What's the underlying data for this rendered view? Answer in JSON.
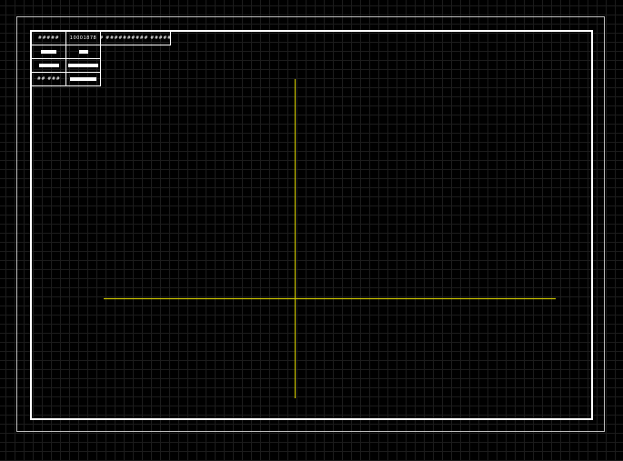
{
  "drawing": {
    "background": "#000000",
    "grid_color": "#1c1c1c",
    "frame_color": "#ffffff",
    "axis_color": "#c8c000"
  },
  "title_block": {
    "row1": {
      "label": "#####",
      "number": "10001878",
      "name": "## ########## ######"
    },
    "row4": {
      "label": "## ###"
    }
  }
}
